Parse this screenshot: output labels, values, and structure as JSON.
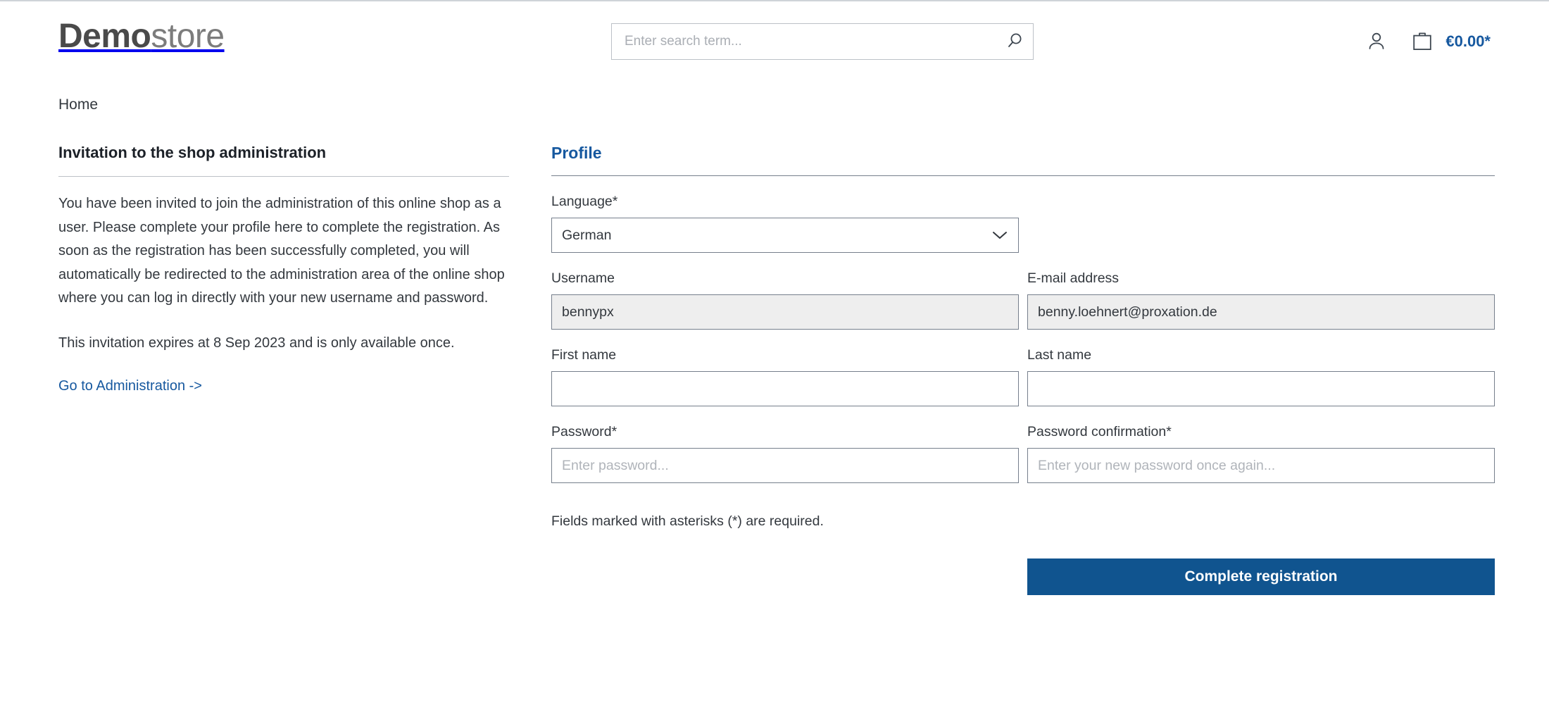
{
  "header": {
    "logo": {
      "bold": "Demo",
      "light": "store"
    },
    "search": {
      "placeholder": "Enter search term...",
      "value": "",
      "icon": "search-icon"
    },
    "account_icon": "person-icon",
    "cart_icon": "shopping-bag-icon",
    "cart_amount": "€0.00*"
  },
  "breadcrumb": {
    "items": [
      {
        "label": "Home"
      }
    ]
  },
  "left": {
    "title": "Invitation to the shop administration",
    "paragraphs": [
      "You have been invited to join the administration of this online shop as a user. Please complete your profile here to complete the registration. As soon as the registration has been successfully completed, you will automatically be redirected to the administration area of the online shop where you can log in directly with your new username and password.",
      "This invitation expires at 8 Sep 2023 and is only available once."
    ],
    "admin_link": "Go to Administration ->"
  },
  "form": {
    "title": "Profile",
    "language": {
      "label": "Language*",
      "selected": "German",
      "options": [
        "German"
      ],
      "chevron_icon": "chevron-down-icon"
    },
    "username": {
      "label": "Username",
      "value": "bennypx",
      "placeholder": ""
    },
    "email": {
      "label": "E-mail address",
      "value": "benny.loehnert@proxation.de",
      "placeholder": ""
    },
    "first_name": {
      "label": "First name",
      "value": "",
      "placeholder": ""
    },
    "last_name": {
      "label": "Last name",
      "value": "",
      "placeholder": ""
    },
    "password": {
      "label": "Password*",
      "value": "",
      "placeholder": "Enter password..."
    },
    "password_confirmation": {
      "label": "Password confirmation*",
      "value": "",
      "placeholder": "Enter your new password once again..."
    },
    "required_note": "Fields marked with asterisks (*) are required.",
    "submit_label": "Complete registration"
  },
  "colors": {
    "brand_blue": "#16589f",
    "button_blue": "#10548f",
    "border_gray": "#767f8c",
    "disabled_bg": "#eeeeee",
    "logo_dark": "#4a4a4a",
    "logo_light": "#7c7c7c"
  }
}
